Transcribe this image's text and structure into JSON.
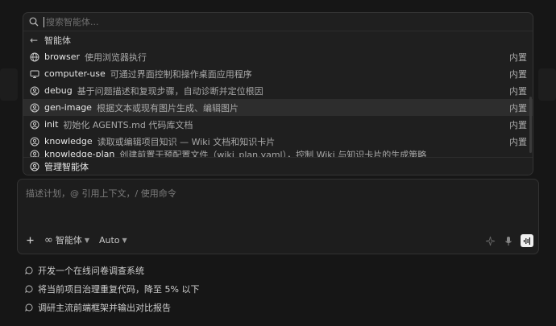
{
  "search": {
    "placeholder": "搜索智能体..."
  },
  "back": {
    "label": "智能体"
  },
  "agents": [
    {
      "name": "browser",
      "desc": "使用浏览器执行",
      "tag": "内置",
      "icon": "globe-icon"
    },
    {
      "name": "computer-use",
      "desc": "可通过界面控制和操作桌面应用程序",
      "tag": "内置",
      "icon": "monitor-icon"
    },
    {
      "name": "debug",
      "desc": "基于问题描述和复现步骤，自动诊断并定位根因",
      "tag": "内置",
      "icon": "agent-icon"
    },
    {
      "name": "gen-image",
      "desc": "根据文本或现有图片生成、编辑图片",
      "tag": "内置",
      "icon": "agent-icon"
    },
    {
      "name": "init",
      "desc": "初始化 AGENTS.md 代码库文档",
      "tag": "内置",
      "icon": "agent-icon"
    },
    {
      "name": "knowledge",
      "desc": "读取或编辑项目知识 — Wiki 文档和知识卡片",
      "tag": "内置",
      "icon": "agent-icon"
    },
    {
      "name": "knowledge-plan",
      "desc": "创建前置干预配置文件（wiki_plan.yaml），控制 Wiki 与知识卡片的生成策略",
      "tag": "",
      "icon": "agent-icon"
    }
  ],
  "manage": {
    "label": "管理智能体"
  },
  "composer": {
    "placeholder": "描述计划，@ 引用上下文，/ 使用命令",
    "agent_label": "智能体",
    "model_label": "Auto"
  },
  "suggestions": [
    {
      "text": "开发一个在线问卷调查系统"
    },
    {
      "text": "将当前项目治理重复代码，降至 5% 以下"
    },
    {
      "text": "调研主流前端框架并输出对比报告"
    }
  ]
}
